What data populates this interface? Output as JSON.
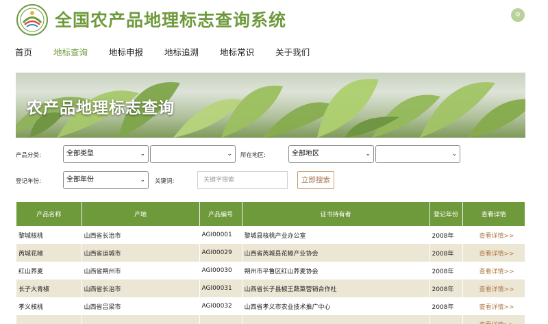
{
  "header": {
    "site_title": "全国农产品地理标志查询系统",
    "logo_icon": "gi-logo-icon",
    "user_icon": "user-circle-icon",
    "user_glyph": "⚙"
  },
  "nav": {
    "items": [
      {
        "label": "首页"
      },
      {
        "label": "地标查询",
        "active": true
      },
      {
        "label": "地标申报"
      },
      {
        "label": "地标追溯"
      },
      {
        "label": "地标常识"
      },
      {
        "label": "关于我们"
      }
    ]
  },
  "banner": {
    "title": "农产品地理标志查询"
  },
  "filters": {
    "category_label": "产品分类:",
    "category_value": "全部类型",
    "subcategory_value": "",
    "region_label": "所在地区:",
    "region_value": "全部地区",
    "subregion_value": "",
    "year_label": "登记年份:",
    "year_value": "全部年份",
    "keyword_label": "关键词:",
    "keyword_placeholder": "关键字搜索",
    "search_label": "立即搜索"
  },
  "table": {
    "headers": [
      "产品名称",
      "产地",
      "产品编号",
      "证书持有者",
      "登记年份",
      "查看详情"
    ],
    "rows": [
      {
        "name": "黎城核桃",
        "origin": "山西省长治市",
        "code": "AGI00001",
        "holder": "黎城县核桃产业办公室",
        "year": "2008年",
        "detail": "查看详情>>"
      },
      {
        "name": "芮城花椒",
        "origin": "山西省运城市",
        "code": "AGI00029",
        "holder": "山西省芮城县花椒产业协会",
        "year": "2008年",
        "detail": "查看详情>>"
      },
      {
        "name": "红山荞麦",
        "origin": "山西省朔州市",
        "code": "AGI00030",
        "holder": "朔州市平鲁区红山荞麦协会",
        "year": "2008年",
        "detail": "查看详情>>"
      },
      {
        "name": "长子大青椒",
        "origin": "山西省长治市",
        "code": "AGI00031",
        "holder": "山西省长子县椒王蔬菜营销合作社",
        "year": "2008年",
        "detail": "查看详情>>"
      },
      {
        "name": "孝义核桃",
        "origin": "山西省吕梁市",
        "code": "AGI00032",
        "holder": "山西省孝义市农业技术推广中心",
        "year": "2008年",
        "detail": "查看详情>>"
      },
      {
        "name": "",
        "origin": "",
        "code": "",
        "holder": "",
        "year": "",
        "detail": "查看详情>>"
      }
    ]
  },
  "colors": {
    "brand_green": "#6f9a3c",
    "row_alt": "#ece6d4",
    "detail_link": "#b07a48",
    "search_border": "#c89a72"
  }
}
